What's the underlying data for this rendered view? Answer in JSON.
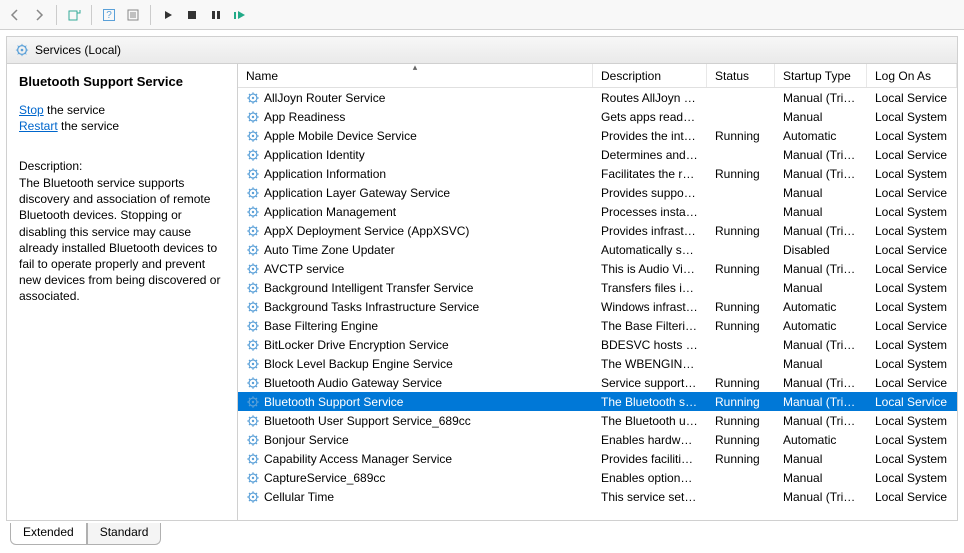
{
  "header": {
    "title": "Services (Local)"
  },
  "left": {
    "selected_name": "Bluetooth Support Service",
    "stop_label": "Stop",
    "stop_suffix": " the service",
    "restart_label": "Restart",
    "restart_suffix": " the service",
    "desc_label": "Description:",
    "desc_text": "The Bluetooth service supports discovery and association of remote Bluetooth devices.  Stopping or disabling this service may cause already installed Bluetooth devices to fail to operate properly and prevent new devices from being discovered or associated."
  },
  "columns": {
    "name": "Name",
    "desc": "Description",
    "status": "Status",
    "startup": "Startup Type",
    "logon": "Log On As"
  },
  "rows": [
    {
      "name": "AllJoyn Router Service",
      "desc": "Routes AllJoyn me...",
      "status": "",
      "startup": "Manual (Trig...",
      "logon": "Local Service",
      "sel": false
    },
    {
      "name": "App Readiness",
      "desc": "Gets apps ready fo...",
      "status": "",
      "startup": "Manual",
      "logon": "Local System",
      "sel": false
    },
    {
      "name": "Apple Mobile Device Service",
      "desc": "Provides the interf...",
      "status": "Running",
      "startup": "Automatic",
      "logon": "Local System",
      "sel": false
    },
    {
      "name": "Application Identity",
      "desc": "Determines and v...",
      "status": "",
      "startup": "Manual (Trig...",
      "logon": "Local Service",
      "sel": false
    },
    {
      "name": "Application Information",
      "desc": "Facilitates the run...",
      "status": "Running",
      "startup": "Manual (Trig...",
      "logon": "Local System",
      "sel": false
    },
    {
      "name": "Application Layer Gateway Service",
      "desc": "Provides support f...",
      "status": "",
      "startup": "Manual",
      "logon": "Local Service",
      "sel": false
    },
    {
      "name": "Application Management",
      "desc": "Processes installat...",
      "status": "",
      "startup": "Manual",
      "logon": "Local System",
      "sel": false
    },
    {
      "name": "AppX Deployment Service (AppXSVC)",
      "desc": "Provides infrastru...",
      "status": "Running",
      "startup": "Manual (Trig...",
      "logon": "Local System",
      "sel": false
    },
    {
      "name": "Auto Time Zone Updater",
      "desc": "Automatically sets...",
      "status": "",
      "startup": "Disabled",
      "logon": "Local Service",
      "sel": false
    },
    {
      "name": "AVCTP service",
      "desc": "This is Audio Vide...",
      "status": "Running",
      "startup": "Manual (Trig...",
      "logon": "Local Service",
      "sel": false
    },
    {
      "name": "Background Intelligent Transfer Service",
      "desc": "Transfers files in th...",
      "status": "",
      "startup": "Manual",
      "logon": "Local System",
      "sel": false
    },
    {
      "name": "Background Tasks Infrastructure Service",
      "desc": "Windows infrastru...",
      "status": "Running",
      "startup": "Automatic",
      "logon": "Local System",
      "sel": false
    },
    {
      "name": "Base Filtering Engine",
      "desc": "The Base Filtering ...",
      "status": "Running",
      "startup": "Automatic",
      "logon": "Local Service",
      "sel": false
    },
    {
      "name": "BitLocker Drive Encryption Service",
      "desc": "BDESVC hosts the ...",
      "status": "",
      "startup": "Manual (Trig...",
      "logon": "Local System",
      "sel": false
    },
    {
      "name": "Block Level Backup Engine Service",
      "desc": "The WBENGINE se...",
      "status": "",
      "startup": "Manual",
      "logon": "Local System",
      "sel": false
    },
    {
      "name": "Bluetooth Audio Gateway Service",
      "desc": "Service supportin...",
      "status": "Running",
      "startup": "Manual (Trig...",
      "logon": "Local Service",
      "sel": false
    },
    {
      "name": "Bluetooth Support Service",
      "desc": "The Bluetooth ser...",
      "status": "Running",
      "startup": "Manual (Trig...",
      "logon": "Local Service",
      "sel": true
    },
    {
      "name": "Bluetooth User Support Service_689cc",
      "desc": "The Bluetooth use...",
      "status": "Running",
      "startup": "Manual (Trig...",
      "logon": "Local System",
      "sel": false
    },
    {
      "name": "Bonjour Service",
      "desc": "Enables hardware ...",
      "status": "Running",
      "startup": "Automatic",
      "logon": "Local System",
      "sel": false
    },
    {
      "name": "Capability Access Manager Service",
      "desc": "Provides facilities ...",
      "status": "Running",
      "startup": "Manual",
      "logon": "Local System",
      "sel": false
    },
    {
      "name": "CaptureService_689cc",
      "desc": "Enables optional s...",
      "status": "",
      "startup": "Manual",
      "logon": "Local System",
      "sel": false
    },
    {
      "name": "Cellular Time",
      "desc": "This service sets ti...",
      "status": "",
      "startup": "Manual (Trig...",
      "logon": "Local Service",
      "sel": false
    }
  ],
  "tabs": {
    "extended": "Extended",
    "standard": "Standard"
  }
}
